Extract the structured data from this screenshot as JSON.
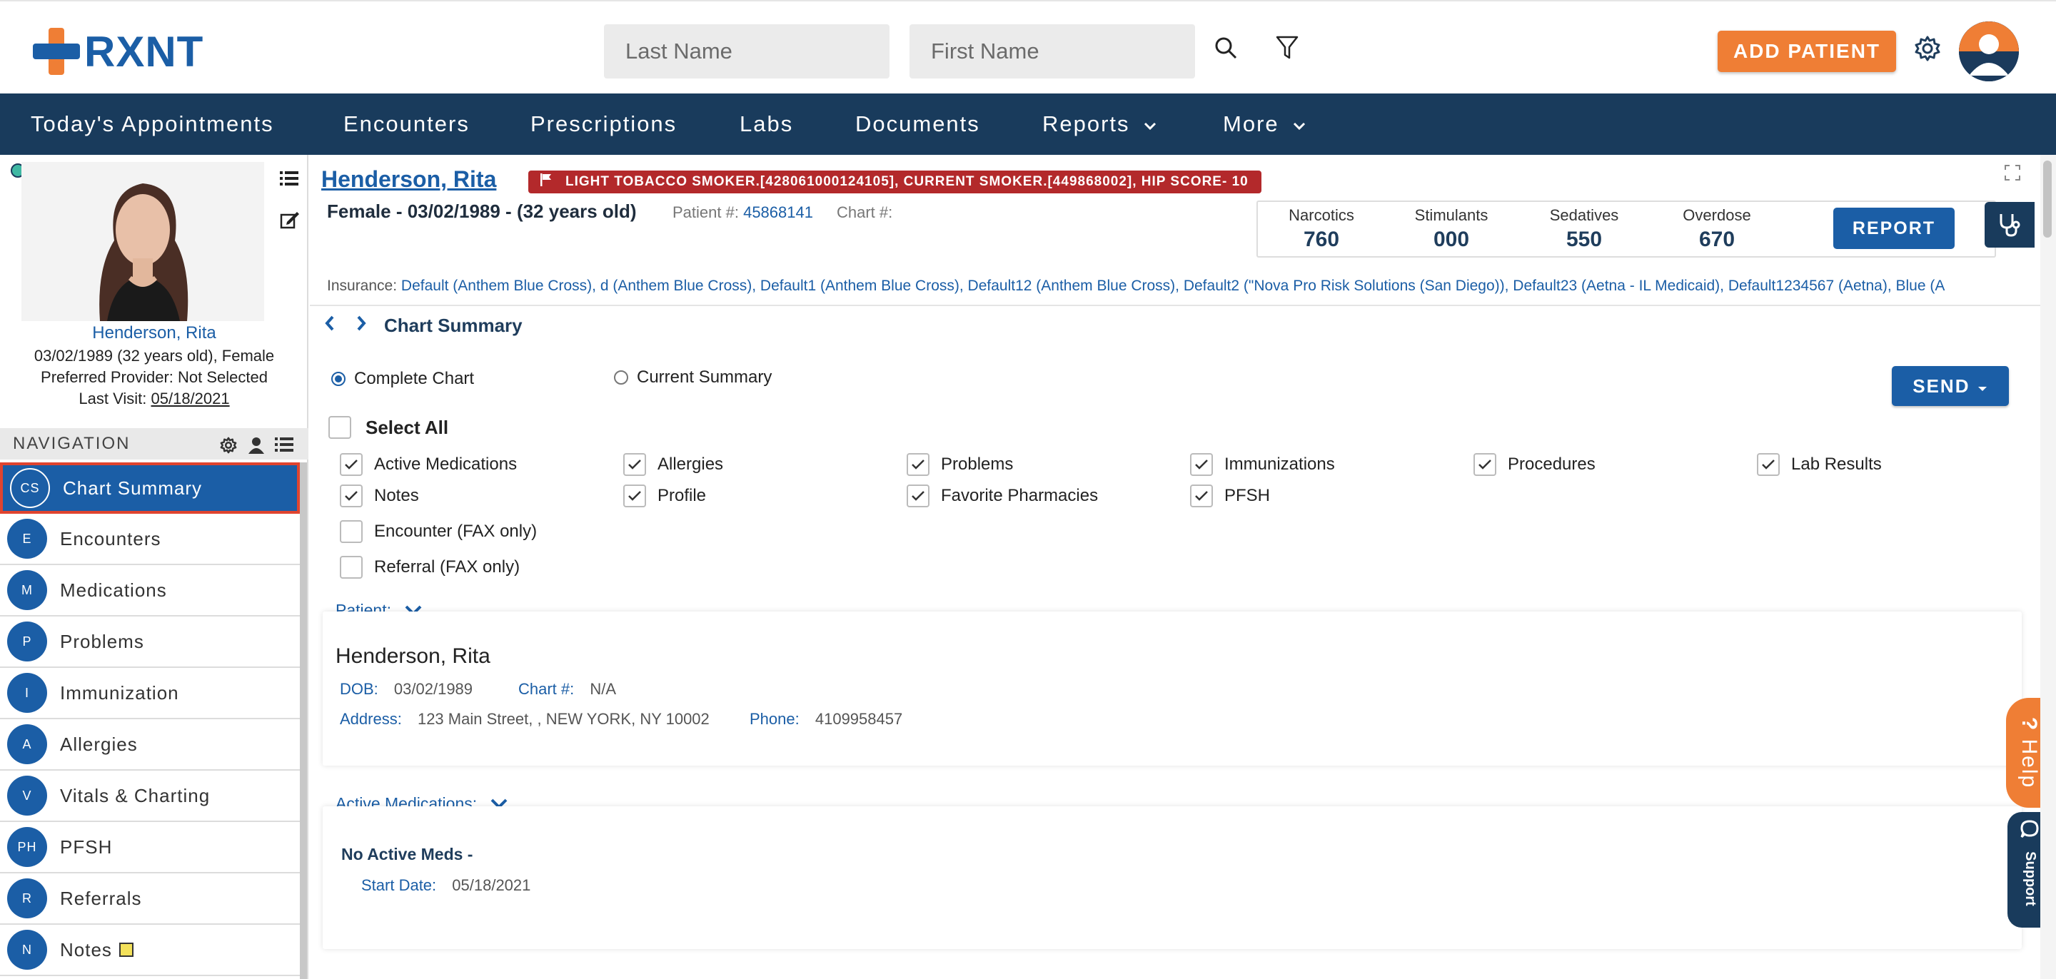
{
  "app": {
    "brand": "RXNT",
    "colors": {
      "brand_blue": "#1b5ea6",
      "brand_orange": "#ef7e35",
      "nav_bg": "#193b5c",
      "alert_red": "#b3292b",
      "active_outline": "#e0442f"
    }
  },
  "header": {
    "last_name_placeholder": "Last Name",
    "first_name_placeholder": "First Name",
    "add_patient_label": "ADD PATIENT",
    "icons": [
      "search-icon",
      "filter-icon",
      "gear-icon",
      "user-avatar"
    ]
  },
  "nav": {
    "items": [
      {
        "label": "Today's Appointments"
      },
      {
        "label": "Encounters"
      },
      {
        "label": "Prescriptions"
      },
      {
        "label": "Labs"
      },
      {
        "label": "Documents"
      },
      {
        "label": "Reports"
      },
      {
        "label": "More"
      }
    ]
  },
  "patient_card": {
    "name": "Henderson, Rita",
    "dob_line": "03/02/1989 (32 years old), Female",
    "provider_line": "Preferred Provider: Not Selected",
    "last_visit_label": "Last Visit:",
    "last_visit_value": "05/18/2021"
  },
  "sidebar": {
    "title": "NAVIGATION",
    "items": [
      {
        "abbr": "CS",
        "label": "Chart Summary",
        "active": true
      },
      {
        "abbr": "E",
        "label": "Encounters"
      },
      {
        "abbr": "M",
        "label": "Medications"
      },
      {
        "abbr": "P",
        "label": "Problems"
      },
      {
        "abbr": "I",
        "label": "Immunization"
      },
      {
        "abbr": "A",
        "label": "Allergies"
      },
      {
        "abbr": "V",
        "label": "Vitals & Charting"
      },
      {
        "abbr": "PH",
        "label": "PFSH"
      },
      {
        "abbr": "R",
        "label": "Referrals"
      },
      {
        "abbr": "N",
        "label": "Notes"
      }
    ]
  },
  "main": {
    "patient_name": "Henderson, Rita",
    "alert_badge": "LIGHT TOBACCO SMOKER.[428061000124105], CURRENT SMOKER.[449868002], HIP SCORE- 10",
    "demographics": "Female - 03/02/1989 - (32 years old)",
    "patient_num_label": "Patient #:",
    "patient_num_value": "45868141",
    "chart_num_label": "Chart #:",
    "stats": [
      {
        "label": "Narcotics",
        "value": "760"
      },
      {
        "label": "Stimulants",
        "value": "000"
      },
      {
        "label": "Sedatives",
        "value": "550"
      },
      {
        "label": "Overdose",
        "value": "670"
      }
    ],
    "report_label": "REPORT",
    "insurance_label": "Insurance:",
    "insurance_value": "Default (Anthem Blue Cross), d (Anthem Blue Cross), Default1 (Anthem Blue Cross), Default12 (Anthem Blue Cross), Default2 (\"Nova Pro Risk Solutions (San Diego)), Default23 (Aetna - IL Medicaid), Default1234567 (Aetna), Blue (A",
    "breadcrumb": "Chart Summary",
    "radio_complete": "Complete Chart",
    "radio_current": "Current Summary",
    "send_label": "SEND",
    "select_all": "Select All",
    "options": [
      {
        "label": "Active Medications",
        "checked": true
      },
      {
        "label": "Allergies",
        "checked": true
      },
      {
        "label": "Problems",
        "checked": true
      },
      {
        "label": "Immunizations",
        "checked": true
      },
      {
        "label": "Procedures",
        "checked": true
      },
      {
        "label": "Lab Results",
        "checked": true
      },
      {
        "label": "Notes",
        "checked": true
      },
      {
        "label": "Profile",
        "checked": true
      },
      {
        "label": "Favorite Pharmacies",
        "checked": true
      },
      {
        "label": "PFSH",
        "checked": true
      },
      {
        "label": "Encounter (FAX only)",
        "checked": false
      },
      {
        "label": "Referral (FAX only)",
        "checked": false
      }
    ],
    "patient_section": {
      "heading": "Patient:",
      "name": "Henderson, Rita",
      "dob_label": "DOB:",
      "dob_value": "03/02/1989",
      "chart_label": "Chart #:",
      "chart_value": "N/A",
      "address_label": "Address:",
      "address_value": "123 Main Street, , NEW YORK, NY 10002",
      "phone_label": "Phone:",
      "phone_value": "4109958457"
    },
    "meds_section": {
      "heading": "Active Medications:",
      "item_title": "No Active Meds -",
      "start_label": "Start Date:",
      "start_value": "05/18/2021"
    }
  },
  "floating": {
    "help_label": "Help",
    "help_icon": "?",
    "support_label": "Support"
  }
}
